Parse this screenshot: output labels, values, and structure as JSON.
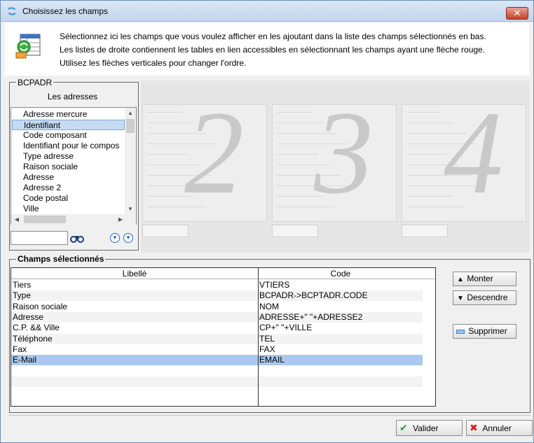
{
  "window": {
    "title": "Choisissez les champs",
    "close_label": "✕"
  },
  "header": {
    "line1": "Sélectionnez ici les champs que vous voulez afficher en les ajoutant dans la liste des champs sélectionnés en bas.",
    "line2": "Les listes de droite contiennent les tables en lien accessibles en sélectionnant les champs ayant une flèche rouge.",
    "line3": "Utilisez les flèches verticales pour changer l'ordre."
  },
  "table_panel": {
    "legend": "BCPADR",
    "subtitle": "Les adresses",
    "search_value": "",
    "items": [
      {
        "label": "Adresse mercure",
        "selected": false
      },
      {
        "label": "Identifiant",
        "selected": true
      },
      {
        "label": "Code composant",
        "selected": false
      },
      {
        "label": "Identifiant pour le compos",
        "selected": false
      },
      {
        "label": "Type adresse",
        "selected": false
      },
      {
        "label": "Raison sociale",
        "selected": false
      },
      {
        "label": "Adresse",
        "selected": false
      },
      {
        "label": "Adresse 2",
        "selected": false
      },
      {
        "label": "Code postal",
        "selected": false
      },
      {
        "label": "Ville",
        "selected": false
      }
    ]
  },
  "ghost_panels": [
    "2",
    "3",
    "4"
  ],
  "selected_fields": {
    "legend": "Champs sélectionnés",
    "col_label": "Libellé",
    "col_code": "Code",
    "rows": [
      {
        "label": "Tiers",
        "code": "VTIERS"
      },
      {
        "label": "Type",
        "code": "BCPADR->BCPTADR.CODE"
      },
      {
        "label": "Raison sociale",
        "code": "NOM"
      },
      {
        "label": "Adresse",
        "code": "ADRESSE+\" \"+ADRESSE2"
      },
      {
        "label": "C.P. && Ville",
        "code": "CP+\" \"+VILLE"
      },
      {
        "label": "Téléphone",
        "code": "TEL"
      },
      {
        "label": "Fax",
        "code": "FAX"
      },
      {
        "label": "E-Mail",
        "code": "EMAIL"
      }
    ],
    "selected_index": 7
  },
  "buttons": {
    "monter": "Monter",
    "descendre": "Descendre",
    "supprimer": "Supprimer",
    "valider": "Valider",
    "annuler": "Annuler"
  },
  "colors": {
    "selection": "#a9c9ee",
    "accent": "#2f68c0"
  }
}
